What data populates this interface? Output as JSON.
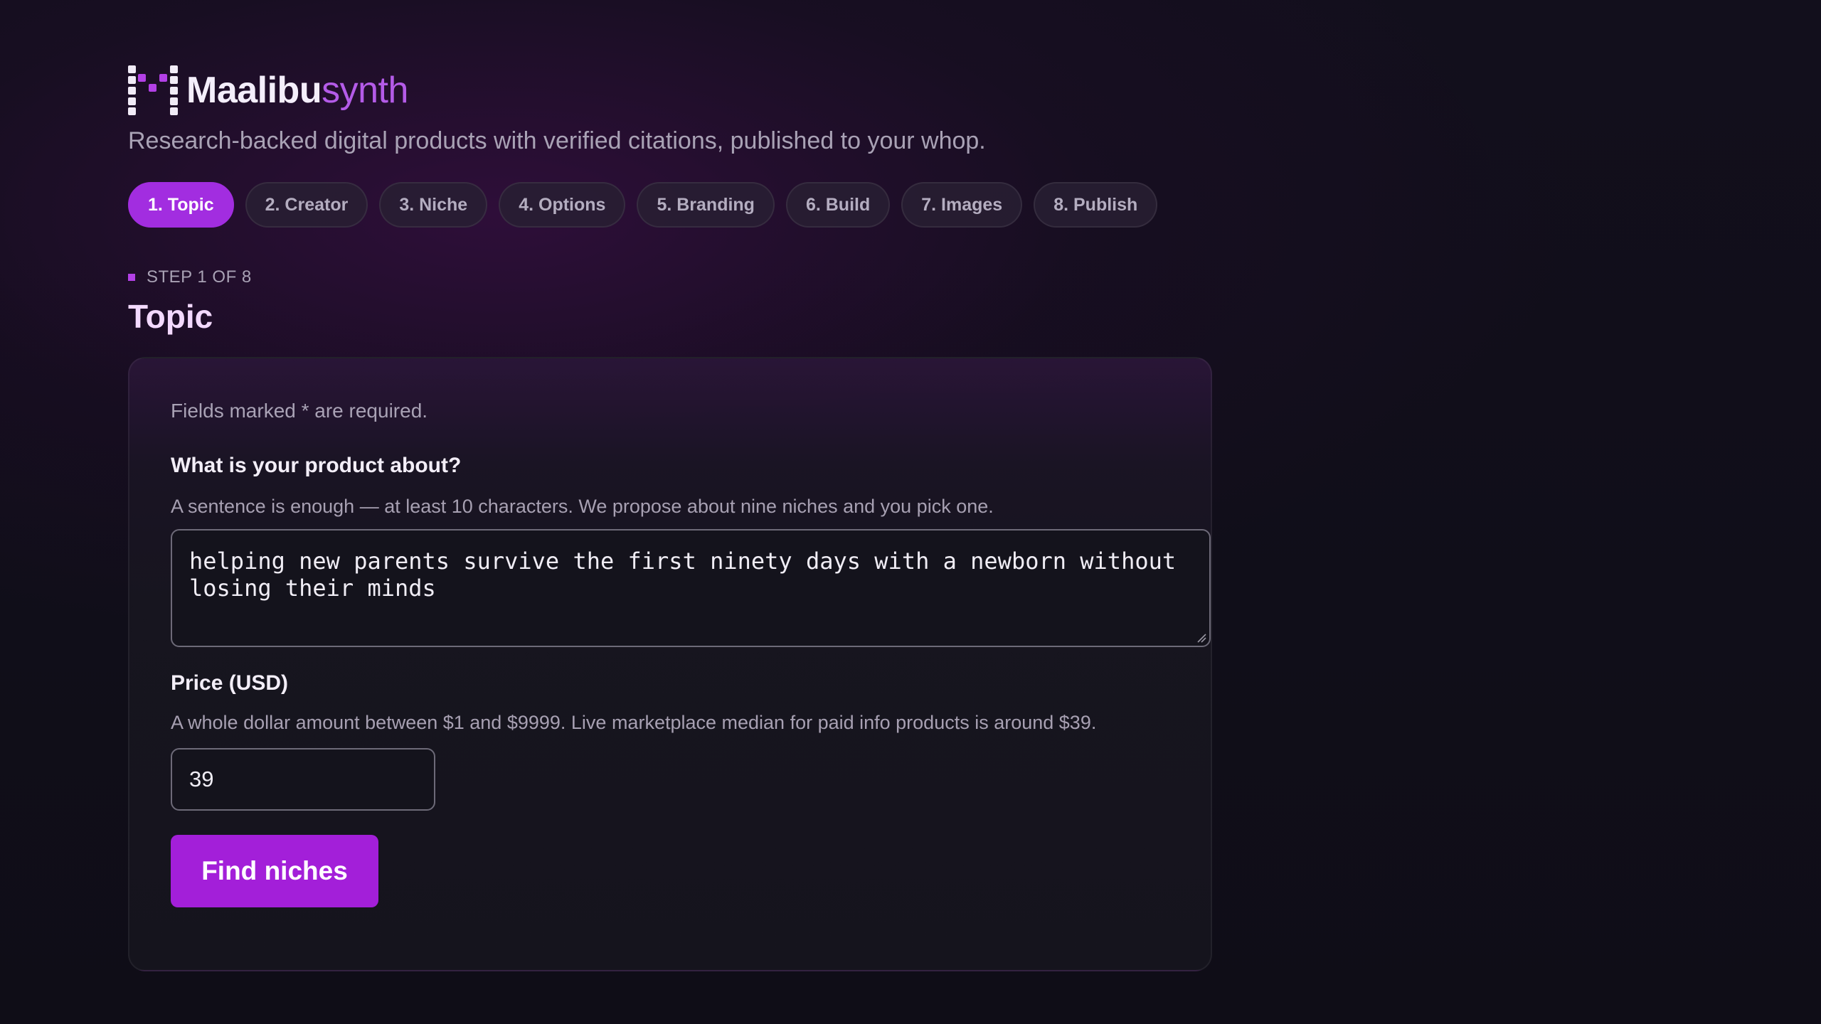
{
  "brand": {
    "name_main": "Maalibu",
    "name_accent": "synth"
  },
  "tagline": "Research-backed digital products with verified citations, published to your whop.",
  "steps": [
    {
      "label": "1. Topic",
      "active": true
    },
    {
      "label": "2. Creator",
      "active": false
    },
    {
      "label": "3. Niche",
      "active": false
    },
    {
      "label": "4. Options",
      "active": false
    },
    {
      "label": "5. Branding",
      "active": false
    },
    {
      "label": "6. Build",
      "active": false
    },
    {
      "label": "7. Images",
      "active": false
    },
    {
      "label": "8. Publish",
      "active": false
    }
  ],
  "step_indicator": "STEP 1 OF 8",
  "page_title": "Topic",
  "form": {
    "required_note": "Fields marked * are required.",
    "topic": {
      "label": "What is your product about?",
      "help": "A sentence is enough — at least 10 characters. We propose about nine niches and you pick one.",
      "value": "helping new parents survive the first ninety days with a newborn without losing their minds"
    },
    "price": {
      "label": "Price (USD)",
      "help": "A whole dollar amount between $1 and $9999. Live marketplace median for paid info products is around $39.",
      "value": "39"
    },
    "submit_label": "Find niches"
  },
  "colors": {
    "accent": "#a22de0",
    "button": "#a31fd9",
    "brand_accent": "#b45be8",
    "background": "#0e0d16"
  }
}
